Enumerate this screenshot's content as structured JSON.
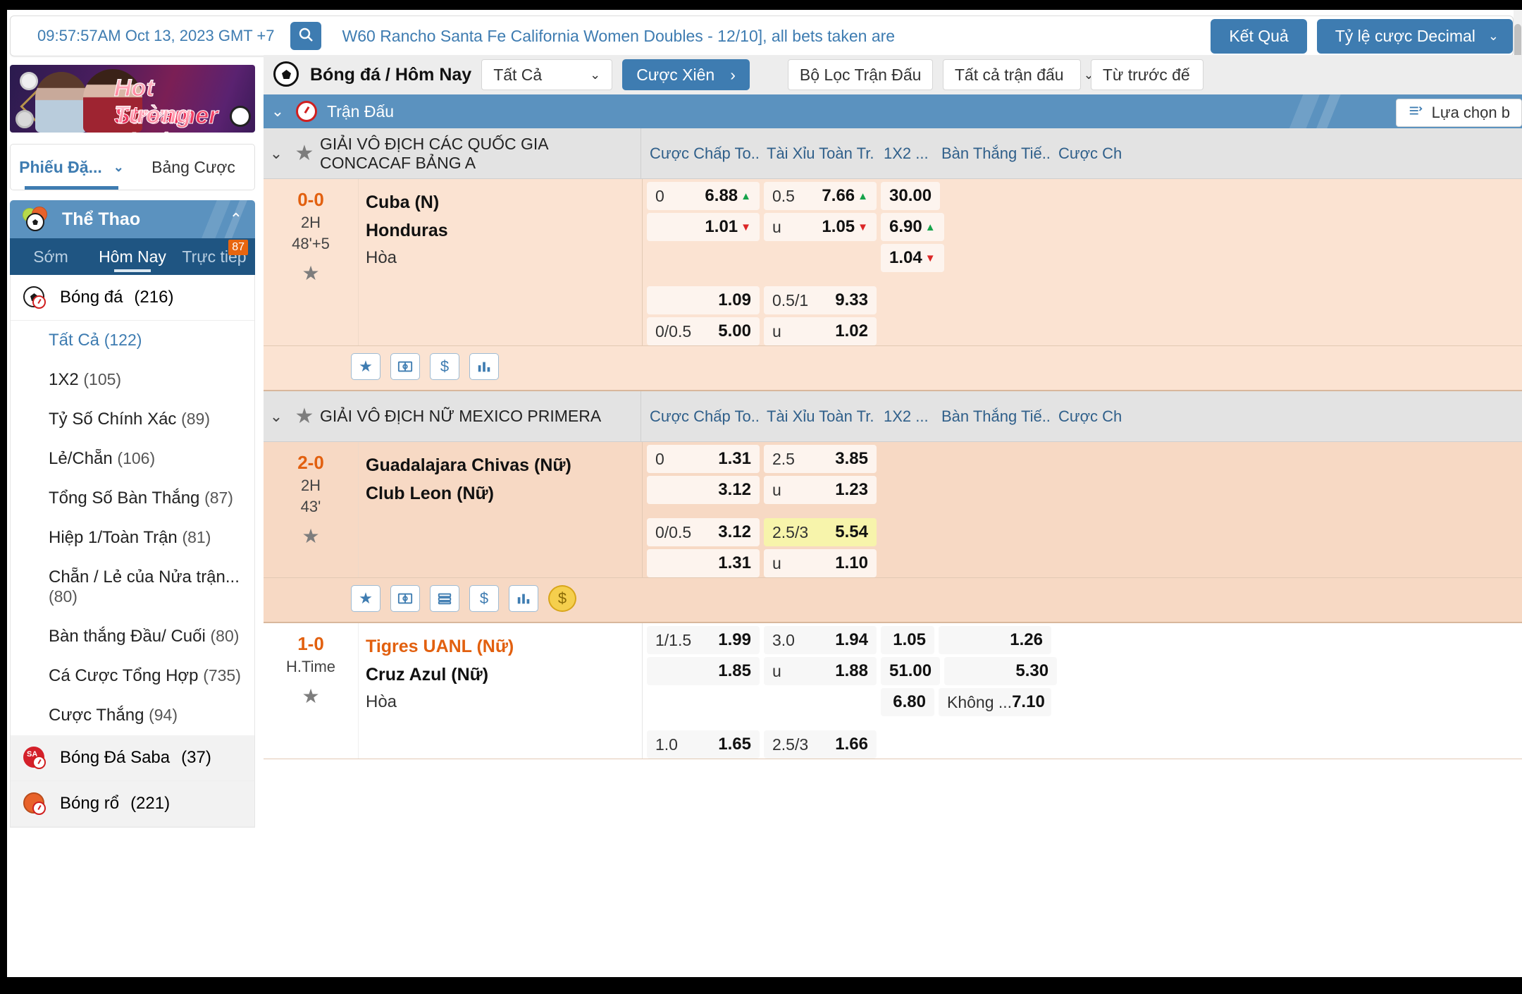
{
  "topbar": {
    "clock": "09:57:57AM Oct 13, 2023 GMT +7",
    "search_icon": "search-icon",
    "marquee": "W60 Rancho Santa Fe California Women Doubles - 12/10], all bets taken are",
    "results_button": "Kết Quả",
    "odds_format": "Tỷ lệ cược Decimal",
    "chevron": "⌄"
  },
  "promo": {
    "line1": "Hot Streamer",
    "line2": "Tường Thuật"
  },
  "betslip": {
    "tab_active": "Phiếu Đặ...",
    "tab_chevron": "⌄",
    "tab_other": "Bảng Cược"
  },
  "sports_panel": {
    "title": "Thể Thao",
    "collapse_caret": "⌃",
    "tabs": [
      {
        "label": "Sớm",
        "active": false,
        "badge": ""
      },
      {
        "label": "Hôm Nay",
        "active": true,
        "badge": ""
      },
      {
        "label": "Trực tiếp",
        "active": false,
        "badge": "87"
      }
    ]
  },
  "sidebar": {
    "football": {
      "label": "Bóng đá",
      "count": "(216)",
      "icon": "soccer-ball-clock-icon"
    },
    "markets": [
      {
        "label": "Tất Cả",
        "count": "(122)",
        "active": true
      },
      {
        "label": "1X2",
        "count": "(105)",
        "active": false
      },
      {
        "label": "Tỷ Số Chính Xác",
        "count": "(89)",
        "active": false
      },
      {
        "label": "Lẻ/Chẵn",
        "count": "(106)",
        "active": false
      },
      {
        "label": "Tổng Số Bàn Thắng",
        "count": "(87)",
        "active": false
      },
      {
        "label": "Hiệp 1/Toàn Trận",
        "count": "(81)",
        "active": false
      },
      {
        "label": "Chẵn / Lẻ của Nửa trận...",
        "count": "(80)",
        "active": false
      },
      {
        "label": "Bàn thắng Đầu/ Cuối",
        "count": "(80)",
        "active": false
      },
      {
        "label": "Cá Cược Tổng Hợp",
        "count": "(735)",
        "active": false
      },
      {
        "label": "Cược Thắng",
        "count": "(94)",
        "active": false
      }
    ],
    "saba": {
      "label": "Bóng Đá Saba",
      "count": "(37)",
      "icon": "saba-ball-icon"
    },
    "basketball": {
      "label": "Bóng rổ",
      "count": "(221)",
      "icon": "basketball-icon"
    }
  },
  "toolbar": {
    "sport_icon": "soccer-ball-icon",
    "title": "Bóng đá / Hôm Nay",
    "filter_all": "Tất Cả",
    "parlay_button": "Cược Xiên",
    "parlay_arrow": "›",
    "match_filter": "Bộ Lọc Trận Đấu",
    "all_matches": "Tất cả trận đấu",
    "from_before": "Từ trước đế",
    "chevron": "⌄"
  },
  "blueband": {
    "caret": "⌄",
    "clock_icon": "clock-icon",
    "label": "Trận Đấu",
    "options_button": "Lựa chọn b",
    "options_icon": "sort-filter-icon"
  },
  "columns": {
    "handicap": "Cược Chấp To...",
    "over_under": "Tài Xỉu Toàn Tr...",
    "onextwo": "1X2 ...",
    "goals": "Bàn Thắng Tiế...",
    "more": "Cược Ch"
  },
  "leagues": [
    {
      "name": "GIẢI VÔ ĐỊCH CÁC QUỐC GIA CONCACAF BẢNG A",
      "caret": "⌄",
      "star": "★",
      "matches": [
        {
          "score": "0-0",
          "period": "2H",
          "minute": "48'+5",
          "star": "★",
          "home": "Cuba (N)",
          "away": "Honduras",
          "draw": "Hòa",
          "home_highlight": false,
          "rows": [
            {
              "handicap": {
                "line": "0",
                "odd": "6.88",
                "trend": "up"
              },
              "ou": {
                "line": "0.5",
                "odd": "7.66",
                "trend": "up"
              },
              "x12": {
                "odd": "30.00"
              }
            },
            {
              "handicap": {
                "line": "",
                "odd": "1.01",
                "trend": "down"
              },
              "ou": {
                "line": "u",
                "odd": "1.05",
                "trend": "down"
              },
              "x12": {
                "odd": "6.90",
                "trend": "up"
              }
            },
            {
              "handicap": null,
              "ou": null,
              "x12": {
                "odd": "1.04",
                "trend": "down"
              }
            },
            {
              "spacer": true
            },
            {
              "handicap": {
                "line": "",
                "odd": "1.09"
              },
              "ou": {
                "line": "0.5/1",
                "odd": "9.33"
              }
            },
            {
              "handicap": {
                "line": "0/0.5",
                "odd": "5.00"
              },
              "ou": {
                "line": "u",
                "odd": "1.02"
              }
            }
          ],
          "icons": [
            "star-icon",
            "pitch-icon",
            "dollar-icon",
            "stats-icon"
          ]
        }
      ]
    },
    {
      "name": "GIẢI VÔ ĐỊCH NỮ MEXICO PRIMERA",
      "caret": "⌄",
      "star": "★",
      "matches": [
        {
          "score": "2-0",
          "period": "2H",
          "minute": "43'",
          "star": "★",
          "home": "Guadalajara Chivas (Nữ)",
          "away": "Club Leon (Nữ)",
          "draw": "",
          "home_highlight": false,
          "rows": [
            {
              "handicap": {
                "line": "0",
                "odd": "1.31"
              },
              "ou": {
                "line": "2.5",
                "odd": "3.85"
              }
            },
            {
              "handicap": {
                "line": "",
                "odd": "3.12"
              },
              "ou": {
                "line": "u",
                "odd": "1.23"
              }
            },
            {
              "spacer": true
            },
            {
              "handicap": {
                "line": "0/0.5",
                "odd": "3.12"
              },
              "ou": {
                "line": "2.5/3",
                "odd": "5.54",
                "highlight": true
              }
            },
            {
              "handicap": {
                "line": "",
                "odd": "1.31"
              },
              "ou": {
                "line": "u",
                "odd": "1.10"
              }
            }
          ],
          "icons": [
            "star-icon",
            "pitch-icon",
            "ladder-icon",
            "dollar-icon",
            "stats-icon",
            "coin-icon"
          ]
        },
        {
          "score": "1-0",
          "period": "H.Time",
          "minute": "",
          "star": "★",
          "home": "Tigres UANL (Nữ)",
          "away": "Cruz Azul (Nữ)",
          "draw": "Hòa",
          "home_highlight": true,
          "rows": [
            {
              "handicap": {
                "line": "1/1.5",
                "odd": "1.99"
              },
              "ou": {
                "line": "3.0",
                "odd": "1.94"
              },
              "x12": {
                "odd": "1.05"
              },
              "goals": {
                "line": "",
                "odd": "1.26"
              }
            },
            {
              "handicap": {
                "line": "",
                "odd": "1.85"
              },
              "ou": {
                "line": "u",
                "odd": "1.88"
              },
              "x12": {
                "odd": "51.00"
              },
              "goals": {
                "line": "",
                "odd": "5.30"
              }
            },
            {
              "handicap": null,
              "ou": null,
              "x12": {
                "odd": "6.80"
              },
              "goals": {
                "line": "Không ...",
                "odd": "7.10"
              }
            },
            {
              "spacer": true
            },
            {
              "handicap": {
                "line": "1.0",
                "odd": "1.65"
              },
              "ou": {
                "line": "2.5/3",
                "odd": "1.66"
              }
            }
          ],
          "icons": []
        }
      ]
    }
  ]
}
